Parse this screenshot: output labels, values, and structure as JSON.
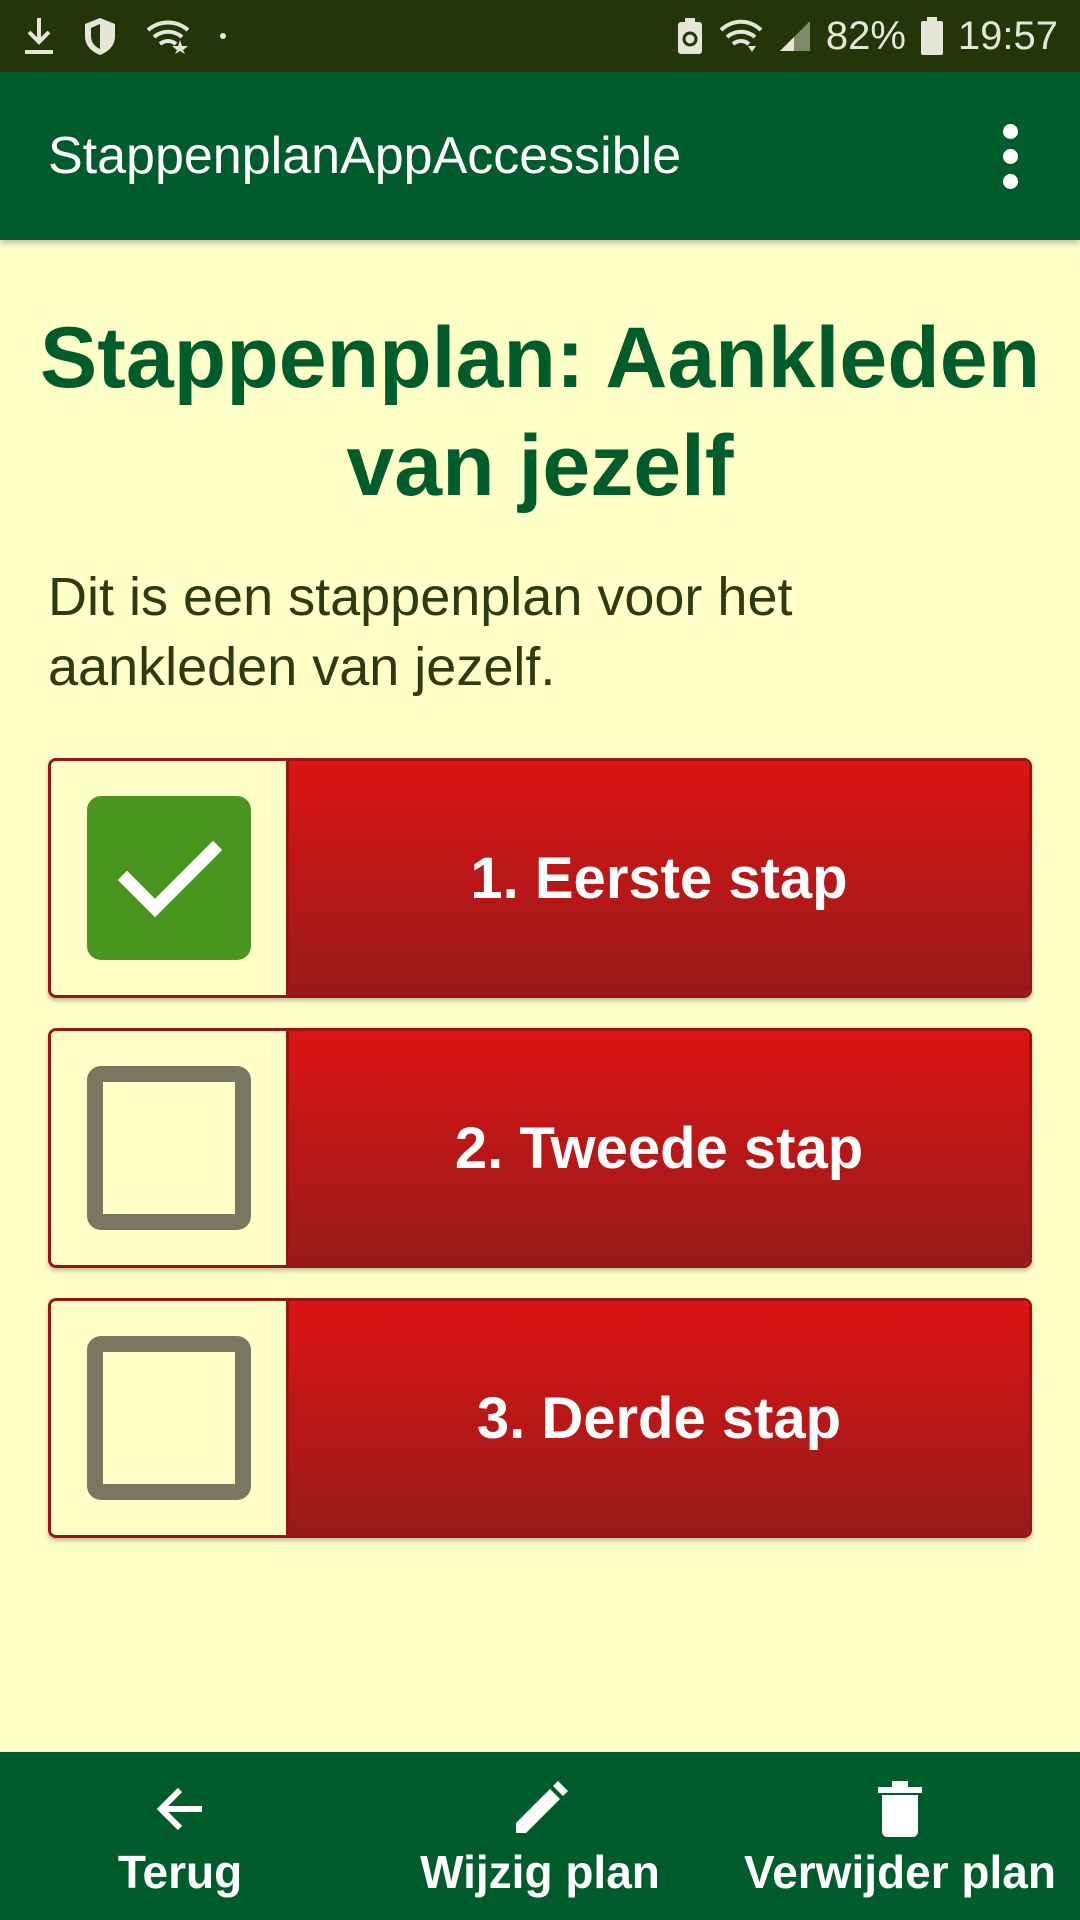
{
  "status_bar": {
    "battery": "82%",
    "time": "19:57",
    "left_icons": [
      "download-icon",
      "shield-icon",
      "wifi-star-icon",
      "dot-icon"
    ],
    "right_icons": [
      "battery-saver-icon",
      "wifi-icon",
      "signal-icon",
      "battery-icon"
    ]
  },
  "app_bar": {
    "title": "StappenplanAppAccessible",
    "menu_icon": "more-vert-icon"
  },
  "plan": {
    "title": "Stappenplan: Aankleden van jezelf",
    "description": "Dit is een stappenplan voor het aankleden van jezelf.",
    "steps": [
      {
        "label": "1. Eerste stap",
        "checked": true
      },
      {
        "label": "2. Tweede stap",
        "checked": false
      },
      {
        "label": "3. Derde stap",
        "checked": false
      }
    ]
  },
  "bottom_nav": {
    "items": [
      {
        "label": "Terug",
        "icon": "arrow-back-icon"
      },
      {
        "label": "Wijzig plan",
        "icon": "edit-icon"
      },
      {
        "label": "Verwijder plan",
        "icon": "delete-icon"
      }
    ]
  },
  "colors": {
    "primary": "#005c2a",
    "background": "#ffffc8",
    "step_red": "#dc1414",
    "check_green": "#4a9420",
    "status_bar": "#22360a"
  }
}
